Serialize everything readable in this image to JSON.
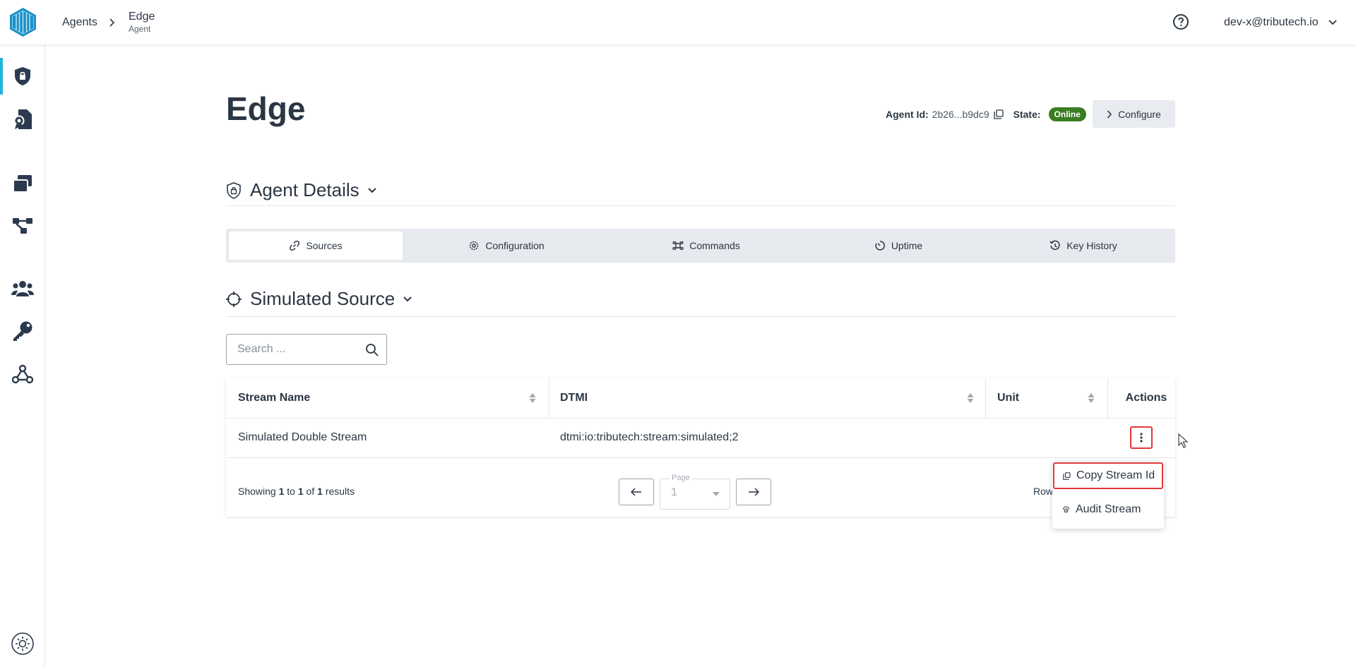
{
  "header": {
    "breadcrumb_root": "Agents",
    "breadcrumb_separator": ">",
    "current_title": "Edge",
    "current_subtitle": "Agent",
    "user_email": "dev-x@tributech.io"
  },
  "sidebar": {
    "items": [
      {
        "icon": "shield-lock-icon",
        "active": true
      },
      {
        "icon": "certificate-file-icon",
        "active": false
      },
      {
        "icon": "stacked-cards-icon",
        "active": false
      },
      {
        "icon": "network-nodes-icon",
        "active": false
      },
      {
        "icon": "users-icon",
        "active": false
      },
      {
        "icon": "key-icon",
        "active": false
      },
      {
        "icon": "webhook-icon",
        "active": false
      }
    ],
    "theme_toggle_icon": "sun-icon"
  },
  "page": {
    "title": "Edge",
    "agent_id_label": "Agent Id:",
    "agent_id_value": "2b26...b9dc9",
    "state_label": "State:",
    "state_value": "Online",
    "configure_label": "Configure",
    "accent_color": "#22b3d8",
    "online_color": "#3a7d22"
  },
  "agent_details": {
    "title": "Agent Details"
  },
  "tabs": [
    {
      "label": "Sources",
      "icon": "link-icon",
      "active": true
    },
    {
      "label": "Configuration",
      "icon": "gear-icon",
      "active": false
    },
    {
      "label": "Commands",
      "icon": "command-icon",
      "active": false
    },
    {
      "label": "Uptime",
      "icon": "timer-icon",
      "active": false
    },
    {
      "label": "Key History",
      "icon": "history-icon",
      "active": false
    }
  ],
  "source": {
    "title": "Simulated Source"
  },
  "search": {
    "placeholder": "Search ..."
  },
  "table": {
    "columns": [
      "Stream Name",
      "DTMI",
      "Unit",
      "Actions"
    ],
    "rows": [
      {
        "stream_name": "Simulated Double Stream",
        "dtmi": "dtmi:io:tributech:stream:simulated;2",
        "unit": ""
      }
    ],
    "footer": {
      "showing_prefix": "Showing",
      "from": "1",
      "to_word": "to",
      "to": "1",
      "of_word": "of",
      "total": "1",
      "results_word": "results",
      "page_label": "Page",
      "page_value": "1",
      "rows_label": "Row"
    }
  },
  "context_menu": {
    "items": [
      {
        "label": "Copy Stream Id",
        "icon": "copy-icon"
      },
      {
        "label": "Audit Stream",
        "icon": "fingerprint-icon"
      }
    ]
  },
  "highlight_color": "#e0383a"
}
